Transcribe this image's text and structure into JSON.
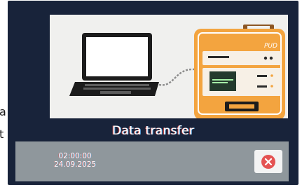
{
  "edge_text": {
    "line1": "a",
    "line2": "t"
  },
  "screen": {
    "title": "Data transfer",
    "time": "02:00:00",
    "date": "24.09.2025",
    "device_label": "PUD"
  },
  "colors": {
    "screen_bg": "#18233a",
    "panel_bg": "#f0f0ee",
    "bar_bg": "#8f979c",
    "device_orange": "#f3a43f",
    "close_red": "#e45252"
  },
  "icons": {
    "laptop": "laptop-icon",
    "device": "pud-device-icon",
    "cable": "cable-icon",
    "close": "close-icon"
  }
}
